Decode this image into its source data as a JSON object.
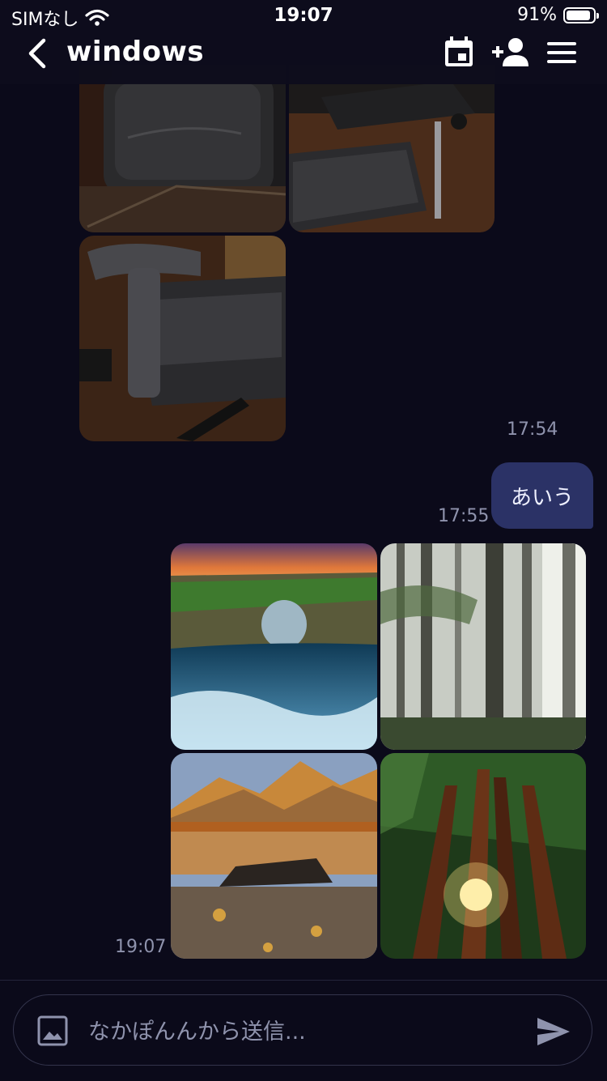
{
  "status_bar": {
    "carrier": "SIMなし",
    "time": "19:07",
    "battery": "91%",
    "battery_level": 0.91
  },
  "header": {
    "title": "windows"
  },
  "messages": {
    "incoming_time": "17:54",
    "outgoing_text": "あいう",
    "outgoing_time": "17:55",
    "photo_time": "19:07"
  },
  "composer": {
    "placeholder": "なかぽんんから送信..."
  },
  "colors": {
    "background": "#0b0a1a",
    "bubble": "#2b3266",
    "muted_text": "#8f93ad"
  }
}
